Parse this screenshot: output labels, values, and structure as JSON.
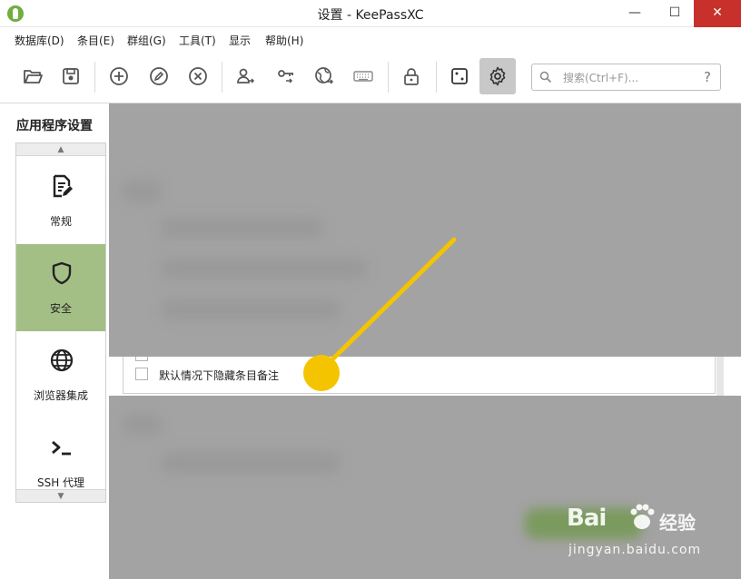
{
  "window": {
    "title": "设置 - KeePassXC",
    "minimize_glyph": "—",
    "maximize_glyph": "☐",
    "close_glyph": "✕"
  },
  "menu": [
    {
      "label": "数据库(D)"
    },
    {
      "label": "条目(E)"
    },
    {
      "label": "群组(G)"
    },
    {
      "label": "工具(T)"
    },
    {
      "label": "显示"
    },
    {
      "label": "帮助(H)"
    }
  ],
  "toolbar": {
    "buttons": [
      {
        "icon": "folder-open-icon"
      },
      {
        "icon": "save-icon"
      },
      {
        "icon": "add-entry-icon"
      },
      {
        "icon": "edit-entry-icon"
      },
      {
        "icon": "delete-entry-icon"
      },
      {
        "icon": "copy-username-icon"
      },
      {
        "icon": "copy-password-icon"
      },
      {
        "icon": "copy-url-icon"
      },
      {
        "icon": "autotype-keyboard-icon"
      },
      {
        "icon": "lock-database-icon"
      },
      {
        "icon": "password-generator-dice-icon"
      },
      {
        "icon": "settings-gear-icon",
        "active": true
      }
    ],
    "search_placeholder": "搜索(Ctrl+F)...",
    "help_glyph": "?"
  },
  "sidebar": {
    "title": "应用程序设置",
    "items": [
      {
        "label": "常规",
        "icon": "document-edit-icon",
        "selected": false
      },
      {
        "label": "安全",
        "icon": "shield-icon",
        "selected": true
      },
      {
        "label": "浏览器集成",
        "icon": "globe-icon",
        "selected": false
      },
      {
        "label": "SSH 代理",
        "icon": "terminal-prompt-icon",
        "selected": false
      }
    ],
    "scroll_up_glyph": "▲",
    "scroll_down_glyph": "▼"
  },
  "settings": {
    "visible_checkbox_label": "默认情况下隐藏条目备注",
    "visible_checkbox_checked": false
  },
  "watermark": {
    "brand": "Bai",
    "brand2": "经验",
    "url": "jingyan.baidu.com"
  },
  "colors": {
    "selected_sidebar": "#a4bf86",
    "annotation_arrow": "#f5c400",
    "overlay_gray": "#a3a3a3",
    "close_button": "#c7302b"
  }
}
